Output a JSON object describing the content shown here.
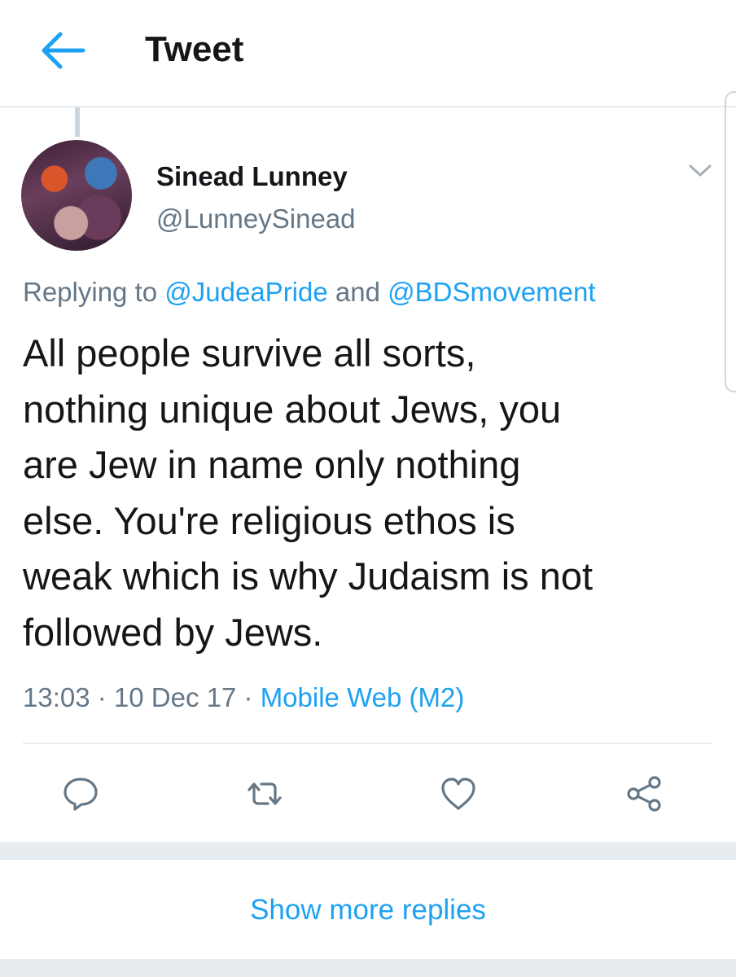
{
  "header": {
    "title": "Tweet"
  },
  "tweet": {
    "author_name": "Sinead Lunney",
    "author_handle": "@LunneySinead",
    "replying_prefix": "Replying to ",
    "reply_mention_1": "@JudeaPride",
    "reply_and": " and ",
    "reply_mention_2": "@BDSmovement",
    "text": "All people survive all sorts,\nnothing unique about Jews, you\nare Jew in name only nothing\nelse. You're religious ethos is\nweak which is why Judaism is not\nfollowed by Jews.",
    "time": "13:03",
    "sep1": " · ",
    "date": "10 Dec 17",
    "sep2": " · ",
    "source": "Mobile Web (M2)"
  },
  "actions": {
    "reply_icon": "reply-icon",
    "retweet_icon": "retweet-icon",
    "like_icon": "heart-icon",
    "share_icon": "share-icon"
  },
  "footer": {
    "show_more": "Show more replies"
  },
  "colors": {
    "accent": "#1da1f2",
    "text": "#14171a",
    "secondary": "#657786",
    "border": "#e6ecf0"
  }
}
